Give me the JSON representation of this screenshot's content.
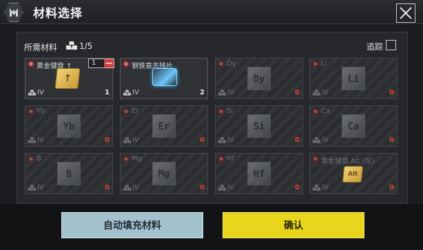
{
  "header": {
    "title": "材料选择"
  },
  "requirements": {
    "label": "所需材料",
    "count": "1/5",
    "track_label": "追踪"
  },
  "stepper": {
    "value": "1",
    "minus": "—"
  },
  "materials": [
    {
      "name": "黄金键盘 ↑",
      "tier": "IV",
      "count": "1",
      "icon": "golden-keycap-up",
      "glyph": "↑"
    },
    {
      "name": "钢铁意志残片",
      "tier": "IV",
      "count": "2",
      "icon": "steel-will-fragment"
    },
    {
      "name": "Dy",
      "tier": "IV",
      "count": "0",
      "icon": "element-cube",
      "glyph": "Dy"
    },
    {
      "name": "Li",
      "tier": "IV",
      "count": "0",
      "icon": "element-cube",
      "glyph": "Li"
    },
    {
      "name": "Yb",
      "tier": "IV",
      "count": "0",
      "icon": "element-cube",
      "glyph": "Yb"
    },
    {
      "name": "Er",
      "tier": "IV",
      "count": "0",
      "icon": "element-cube",
      "glyph": "Er"
    },
    {
      "name": "Si",
      "tier": "IV",
      "count": "0",
      "icon": "element-cube",
      "glyph": "Si"
    },
    {
      "name": "Ca",
      "tier": "IV",
      "count": "0",
      "icon": "element-cube",
      "glyph": "Ca"
    },
    {
      "name": "B",
      "tier": "IV",
      "count": "0",
      "icon": "element-cube",
      "glyph": "B"
    },
    {
      "name": "Mg",
      "tier": "IV",
      "count": "0",
      "icon": "element-cube",
      "glyph": "Mg"
    },
    {
      "name": "Hf",
      "tier": "IV",
      "count": "0",
      "icon": "element-cube",
      "glyph": "Hf"
    },
    {
      "name": "黄金键盘 Alt (左)",
      "tier": "IV",
      "count": "0",
      "icon": "golden-keycap-alt",
      "glyph": "Alt"
    }
  ],
  "buttons": {
    "auto_fill": "自动填充材料",
    "confirm": "确认"
  },
  "colors": {
    "confirm": "#e7d61b",
    "auto_fill": "#a4c2cd",
    "zero_count": "#e0452f",
    "warning": "#8b2b2b"
  }
}
